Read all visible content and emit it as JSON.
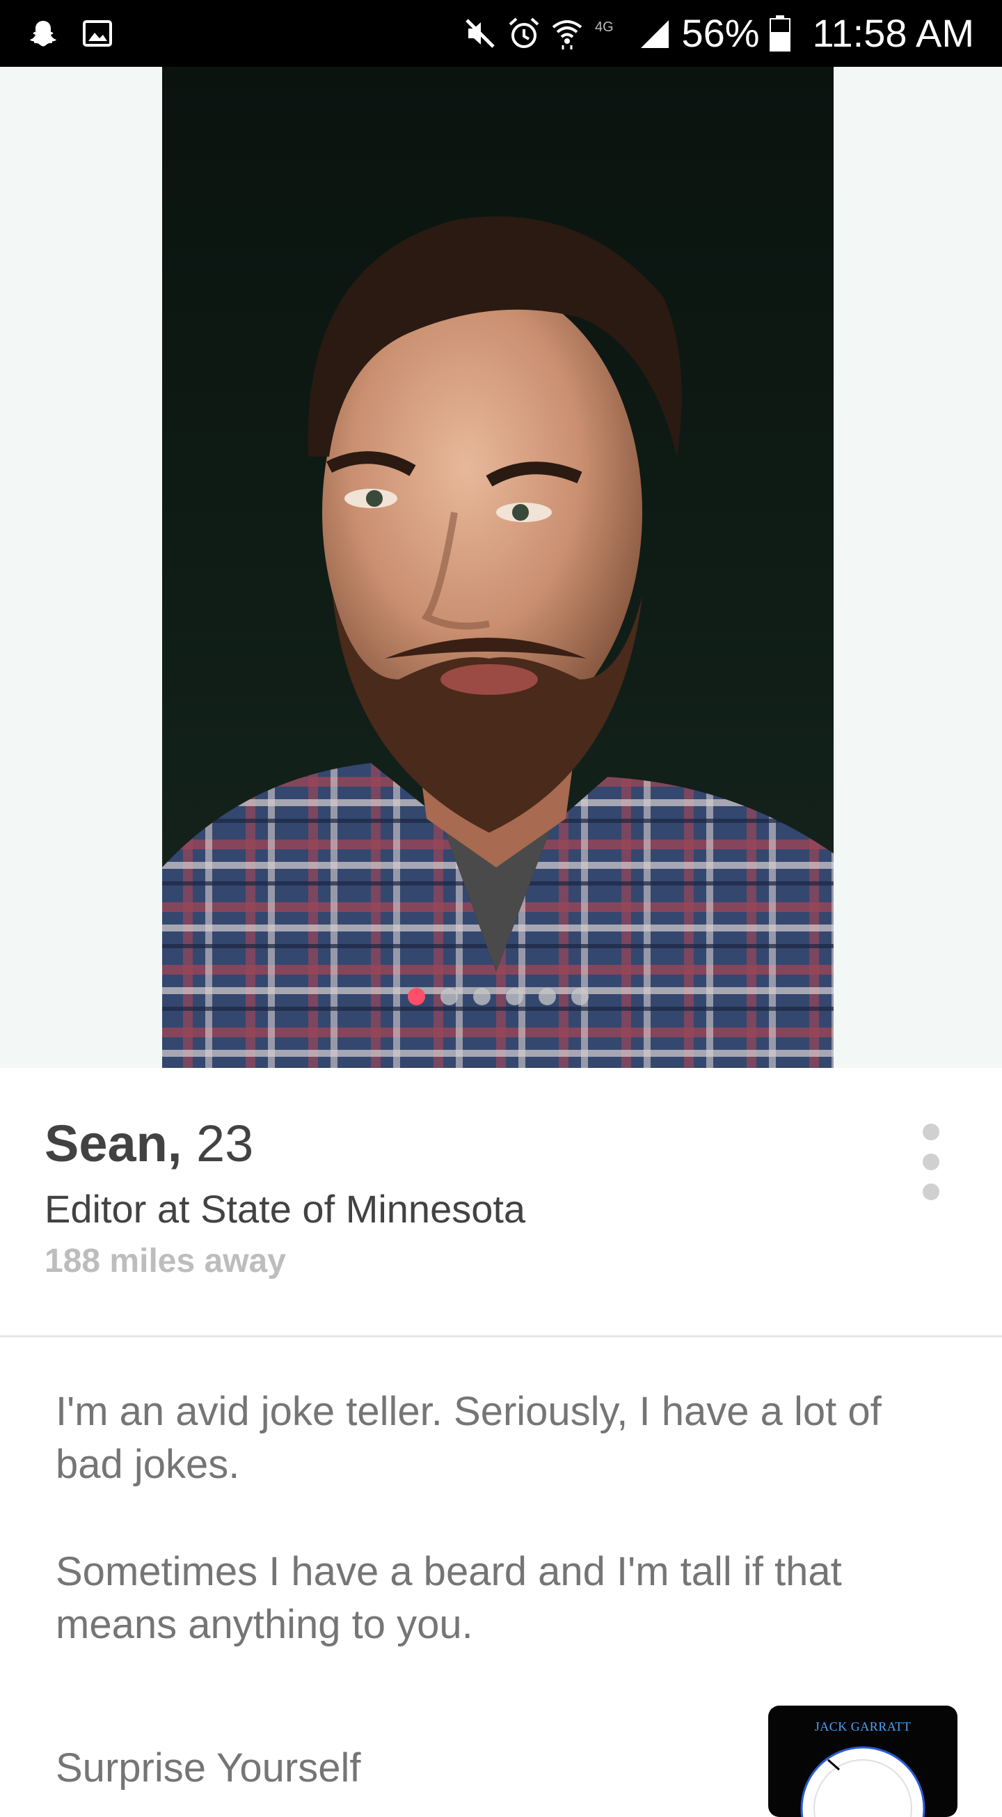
{
  "status_bar": {
    "left_icons": [
      "snapchat-icon",
      "gallery-icon"
    ],
    "right_icons": [
      "mute-icon",
      "alarm-icon",
      "wifi-icon",
      "lte-icon",
      "signal-icon",
      "battery-icon"
    ],
    "network": "4G",
    "battery": "56%",
    "time": "11:58 AM"
  },
  "photo": {
    "description_icon": "profile-photo",
    "count": 6,
    "active_index": 0,
    "active_color": "#fd5068"
  },
  "profile": {
    "name": "Sean,",
    "age": "23",
    "job": "Editor at State of Minnesota",
    "distance": "188 miles away"
  },
  "bio": {
    "paragraph_1": "I'm an avid joke teller. Seriously, I have a lot of bad jokes.",
    "paragraph_2": "Sometimes I have a beard and I'm tall if that means anything to you."
  },
  "anthem": {
    "label": "Surprise Yourself",
    "album_artist": "JACK GARRATT"
  },
  "colors": {
    "accent": "#fd5068",
    "text_primary": "#424242",
    "text_secondary": "#757575",
    "text_muted": "#bdbdbd"
  }
}
